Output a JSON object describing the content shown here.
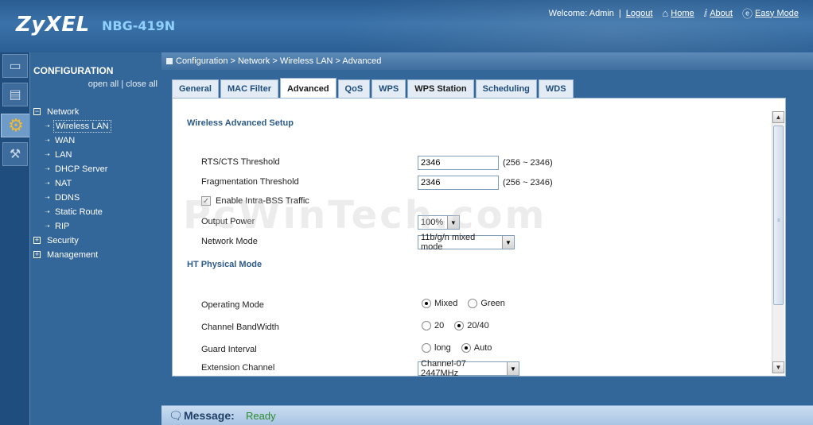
{
  "header": {
    "logo": "ZyXEL",
    "model": "NBG-419N",
    "welcome": "Welcome: Admin",
    "separator": "|",
    "logout": "Logout",
    "home": "Home",
    "about": "About",
    "easy_mode": "Easy Mode"
  },
  "sidebar": {
    "title": "CONFIGURATION",
    "open_all": "open all",
    "divider": "|",
    "close_all": "close all",
    "network": "Network",
    "network_items": [
      "Wireless LAN",
      "WAN",
      "LAN",
      "DHCP Server",
      "NAT",
      "DDNS",
      "Static Route",
      "RIP"
    ],
    "security": "Security",
    "management": "Management"
  },
  "breadcrumb": "Configuration > Network > Wireless LAN > Advanced",
  "tabs": [
    "General",
    "MAC Filter",
    "Advanced",
    "QoS",
    "WPS",
    "WPS Station",
    "Scheduling",
    "WDS"
  ],
  "active_tab": "Advanced",
  "form": {
    "section_wireless": "Wireless Advanced Setup",
    "rts_label": "RTS/CTS Threshold",
    "rts_value": "2346",
    "rts_hint": "(256 ~ 2346)",
    "frag_label": "Fragmentation Threshold",
    "frag_value": "2346",
    "frag_hint": "(256 ~ 2346)",
    "intra_bss_label": "Enable Intra-BSS Traffic",
    "intra_bss_checked": true,
    "output_power_label": "Output Power",
    "output_power_value": "100%",
    "network_mode_label": "Network Mode",
    "network_mode_value": "11b/g/n mixed mode",
    "section_ht": "HT Physical Mode",
    "operating_mode_label": "Operating Mode",
    "operating_mode_options": [
      "Mixed",
      "Green"
    ],
    "operating_mode_selected": "Mixed",
    "bandwidth_label": "Channel BandWidth",
    "bandwidth_options": [
      "20",
      "20/40"
    ],
    "bandwidth_selected": "20/40",
    "guard_label": "Guard Interval",
    "guard_options": [
      "long",
      "Auto"
    ],
    "guard_selected": "Auto",
    "ext_channel_label": "Extension Channel",
    "ext_channel_value": "Channel-07 2447MHz"
  },
  "watermark": "PcWinTech.com",
  "message": {
    "label": "Message:",
    "status": "Ready",
    "status_color": "#2e8b2e"
  }
}
